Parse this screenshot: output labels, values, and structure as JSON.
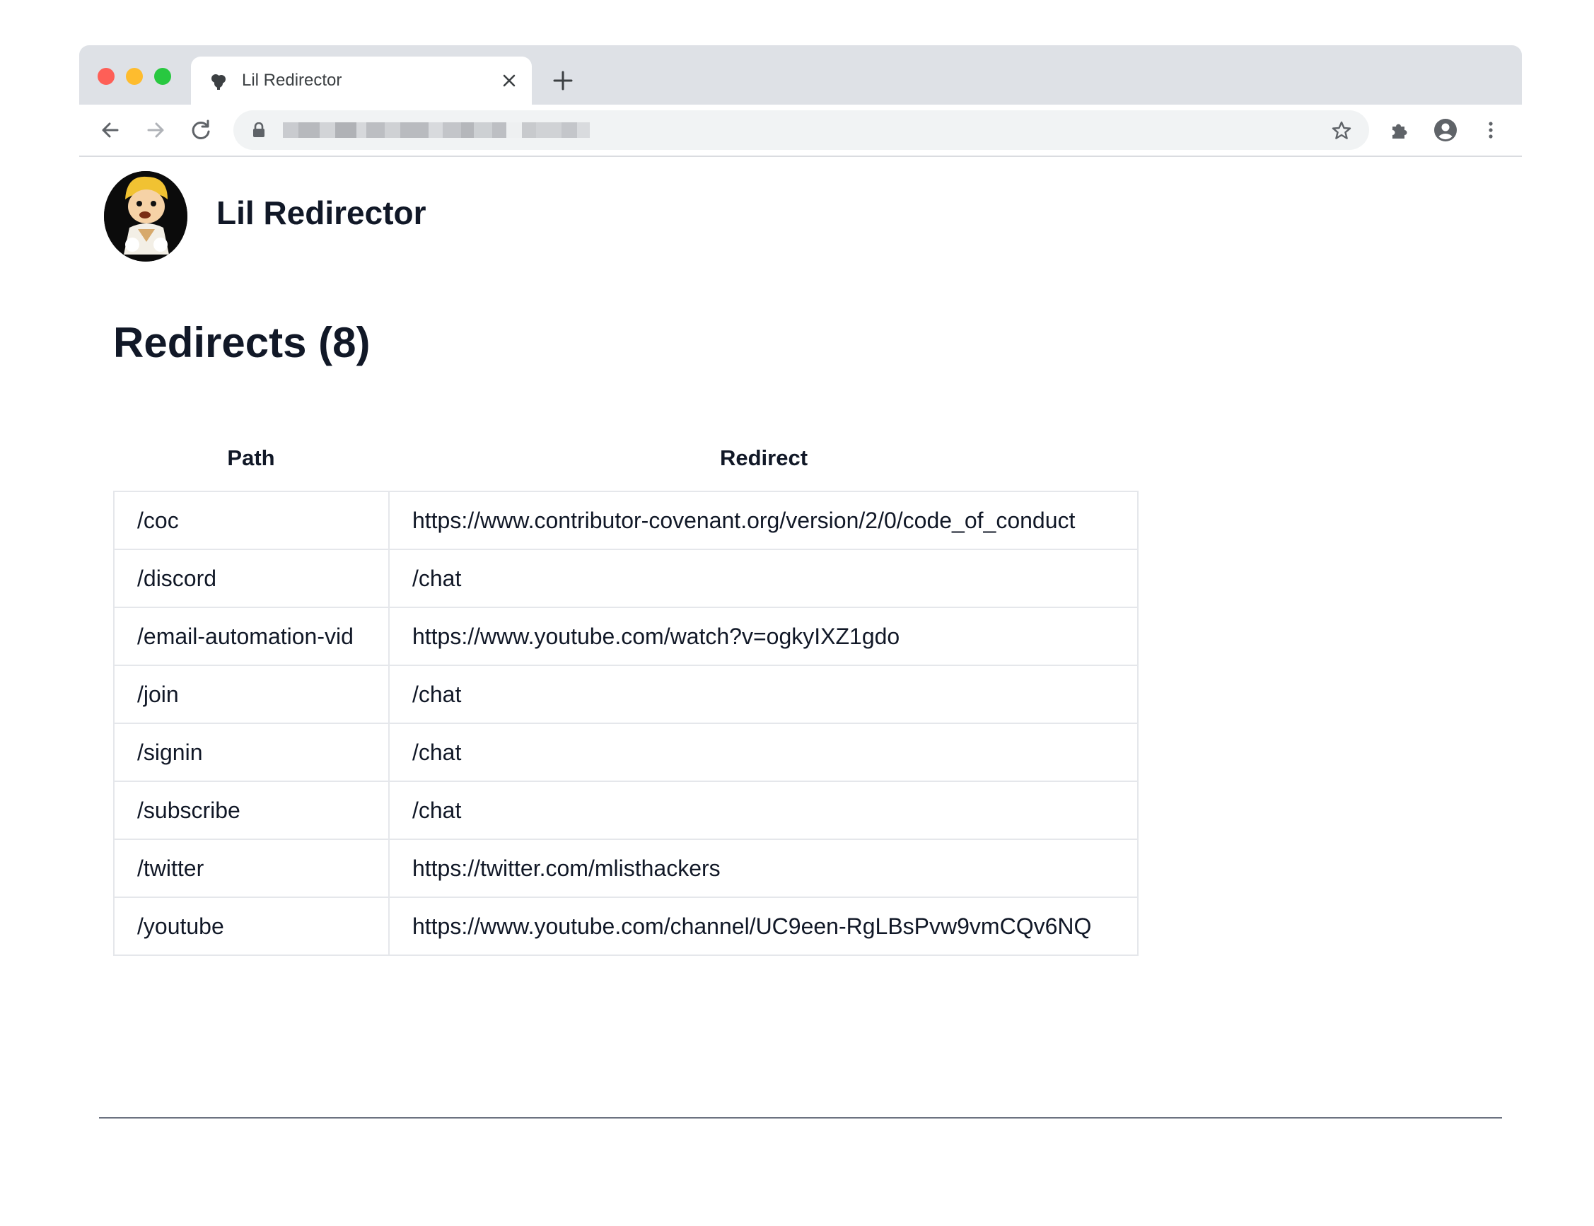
{
  "browser": {
    "tab_title": "Lil Redirector",
    "url": ""
  },
  "header": {
    "brand": "Lil Redirector"
  },
  "main": {
    "heading": "Redirects (8)",
    "columns": [
      "Path",
      "Redirect"
    ],
    "rows": [
      {
        "path": "/coc",
        "redirect": "https://www.contributor-covenant.org/version/2/0/code_of_conduct"
      },
      {
        "path": "/discord",
        "redirect": "/chat"
      },
      {
        "path": "/email-automation-vid",
        "redirect": "https://www.youtube.com/watch?v=ogkyIXZ1gdo"
      },
      {
        "path": "/join",
        "redirect": "/chat"
      },
      {
        "path": "/signin",
        "redirect": "/chat"
      },
      {
        "path": "/subscribe",
        "redirect": "/chat"
      },
      {
        "path": "/twitter",
        "redirect": "https://twitter.com/mlisthackers"
      },
      {
        "path": "/youtube",
        "redirect": "https://www.youtube.com/channel/UC9een-RgLBsPvw9vmCQv6NQ"
      }
    ]
  },
  "icons": {
    "favicon": "puzzle-tree-icon",
    "close": "close-icon",
    "new_tab": "plus-icon",
    "back": "arrow-left-icon",
    "forward": "arrow-right-icon",
    "reload": "reload-icon",
    "lock": "lock-icon",
    "bookmark": "star-icon",
    "extensions": "puzzle-icon",
    "profile": "account-icon",
    "menu": "kebab-menu-icon"
  },
  "colors": {
    "tabstrip": "#dee1e6",
    "omnibox": "#f1f3f4",
    "close_dot": "#fe5f57",
    "minimize_dot": "#febc2e",
    "zoom_dot": "#28c840",
    "table_border": "#e5e7eb",
    "text": "#111827"
  }
}
